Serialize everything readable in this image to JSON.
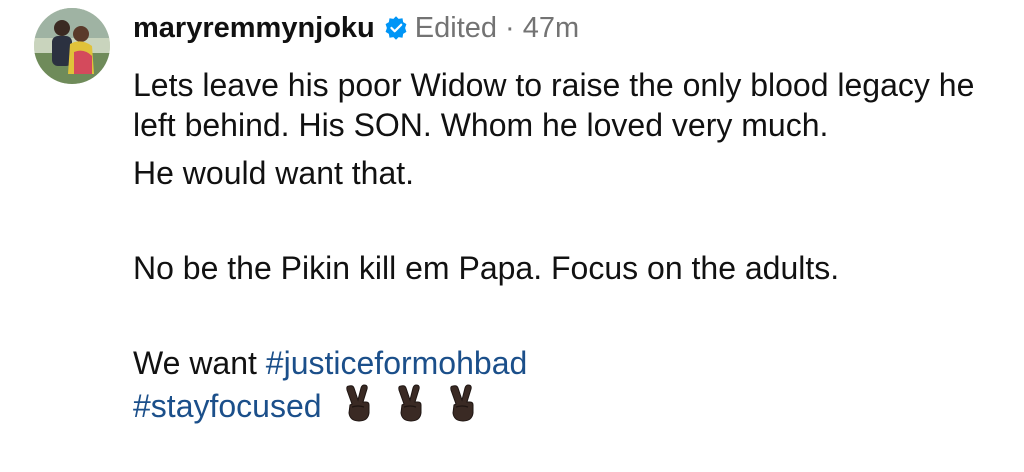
{
  "comment": {
    "username": "maryremmynjoku",
    "verified_icon": "verified-badge-icon",
    "edited_label": "Edited",
    "separator": "·",
    "time": "47m",
    "paragraph1": "Lets leave his poor Widow to raise the only blood legacy he left behind. His SON. Whom he loved very much.",
    "paragraph2": "He would want that.",
    "paragraph3": "No be the Pikin kill em Papa. Focus on the adults.",
    "paragraph4_prefix": "We want ",
    "hashtag1": "#justiceformohbad",
    "hashtag2": "#stayfocused",
    "emoji_name": "victory-hand-dark-skin-tone"
  },
  "colors": {
    "link": "#1b4f8a",
    "muted": "#737373",
    "verified": "#0095f6",
    "text": "#111111"
  }
}
